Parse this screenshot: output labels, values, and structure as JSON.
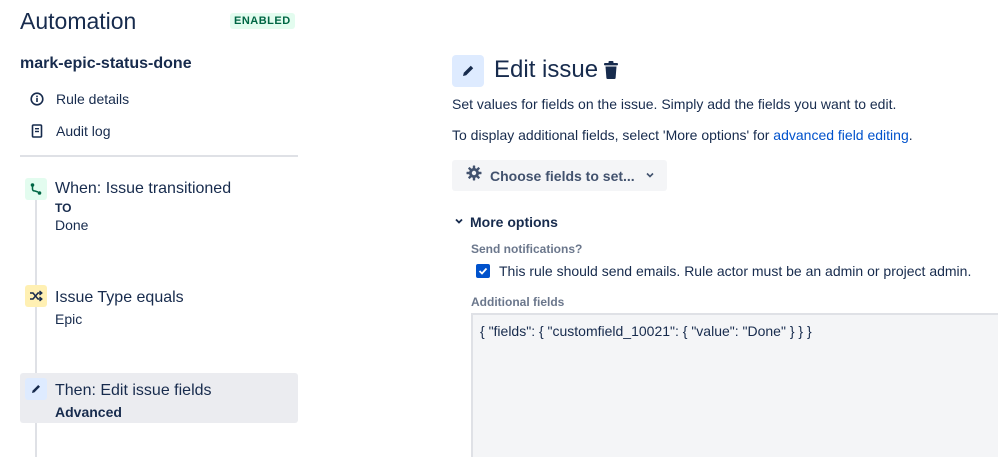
{
  "header": {
    "title": "Automation",
    "status": "ENABLED"
  },
  "sidebar": {
    "rule_name": "mark-epic-status-done",
    "links": [
      {
        "label": "Rule details",
        "icon": "info-icon"
      },
      {
        "label": "Audit log",
        "icon": "document-icon"
      }
    ],
    "steps": [
      {
        "title": "When: Issue transitioned",
        "sub1": "TO",
        "sub2": "Done",
        "icon": "transition-icon",
        "color": "#E3FCEF"
      },
      {
        "title": "Issue Type equals",
        "sub1": "Epic",
        "icon": "shuffle-icon",
        "color": "#FFF0B3"
      },
      {
        "title": "Then: Edit issue fields",
        "sub1": "Advanced",
        "icon": "pencil-icon",
        "color": "#DEEBFF",
        "active": true
      }
    ]
  },
  "main": {
    "title": "Edit issue",
    "desc1": "Set values for fields on the issue. Simply add the fields you want to edit.",
    "desc2_prefix": "To display additional fields, select 'More options' for ",
    "desc2_link": "advanced field editing",
    "desc2_suffix": ".",
    "choose_fields_label": "Choose fields to set...",
    "more_options_label": "More options",
    "send_notifications_label": "Send notifications?",
    "send_notifications_checkbox_label": "This rule should send emails. Rule actor must be an admin or project admin.",
    "send_notifications_checked": true,
    "additional_fields_label": "Additional fields",
    "additional_fields_value": "{ \"fields\": { \"customfield_10021\": { \"value\": \"Done\" } } }"
  },
  "colors": {
    "accent": "#0052CC",
    "text": "#172B4D",
    "enabled_bg": "#E3FCEF",
    "enabled_text": "#006644"
  }
}
